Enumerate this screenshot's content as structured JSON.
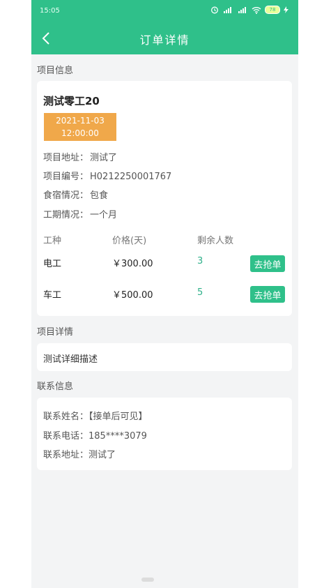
{
  "status_bar": {
    "time": "15:05",
    "battery": "78"
  },
  "header": {
    "title": "订单详情"
  },
  "sections": {
    "project_info": "项目信息",
    "project_detail": "项目详情",
    "contact_info": "联系信息"
  },
  "project": {
    "name": "测试零工20",
    "date": "2021-11-03",
    "time": "12:00:00",
    "fields": [
      {
        "label": "项目地址：",
        "value": "测试了"
      },
      {
        "label": "项目编号：",
        "value": "H0212250001767"
      },
      {
        "label": "食宿情况：",
        "value": "包食"
      },
      {
        "label": "工期情况：",
        "value": "一个月"
      }
    ]
  },
  "table": {
    "headers": [
      "工种",
      "价格(天)",
      "剩余人数"
    ],
    "rows": [
      {
        "type": "电工",
        "price": "￥300.00",
        "remaining": "3",
        "action": "去抢单"
      },
      {
        "type": "车工",
        "price": "￥500.00",
        "remaining": "5",
        "action": "去抢单"
      }
    ]
  },
  "detail": {
    "description": "测试详细描述"
  },
  "contact": [
    {
      "label": "联系姓名：",
      "value": "【接单后可见】"
    },
    {
      "label": "联系电话：",
      "value": "185****3079"
    },
    {
      "label": "联系地址：",
      "value": "测试了"
    }
  ],
  "colors": {
    "brand": "#2fc08a",
    "badge": "#f0a84a",
    "count": "#2fb08a"
  }
}
